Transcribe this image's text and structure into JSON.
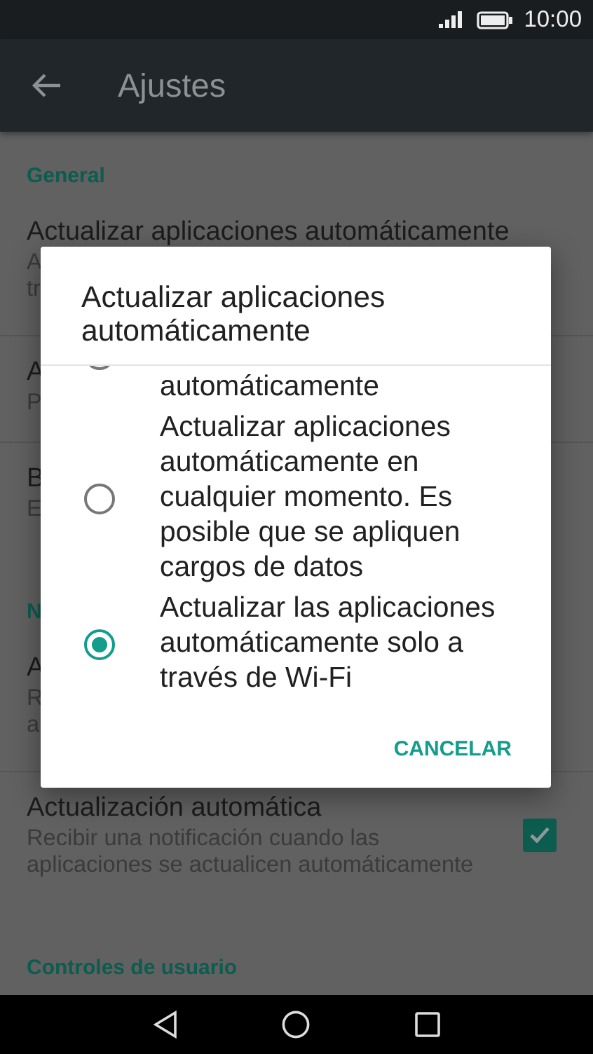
{
  "status_bar": {
    "time": "10:00"
  },
  "app_bar": {
    "title": "Ajustes"
  },
  "settings": [
    {
      "kind": "header",
      "title": "General"
    },
    {
      "kind": "item",
      "title": "Actualizar aplicaciones automáticamente",
      "subtitle": [
        "A",
        "tr"
      ]
    },
    {
      "kind": "item",
      "title": "A",
      "subtitle": [
        "P"
      ]
    },
    {
      "kind": "item",
      "title": "B",
      "subtitle": [
        "E"
      ]
    },
    {
      "kind": "header",
      "title": "N"
    },
    {
      "kind": "item",
      "title": "A",
      "subtitle": [
        "R",
        "a"
      ]
    },
    {
      "kind": "check",
      "title": "Actualización automática",
      "subtitle": [
        "Recibir una notificación cuando las",
        "aplicaciones se actualicen automáticamente"
      ],
      "checked": true
    },
    {
      "kind": "header",
      "title": "Controles de usuario"
    }
  ],
  "dialog": {
    "title": "Actualizar aplicaciones automáticamente",
    "options": [
      {
        "label": "automáticamente",
        "selected": false
      },
      {
        "label": "Actualizar aplicaciones automáticamente en cualquier momento. Es posible que se apliquen cargos de datos",
        "selected": false
      },
      {
        "label": "Actualizar las aplicaciones automáticamente solo a través de Wi-Fi",
        "selected": true
      }
    ],
    "buttons": [
      "CANCELAR"
    ]
  }
}
